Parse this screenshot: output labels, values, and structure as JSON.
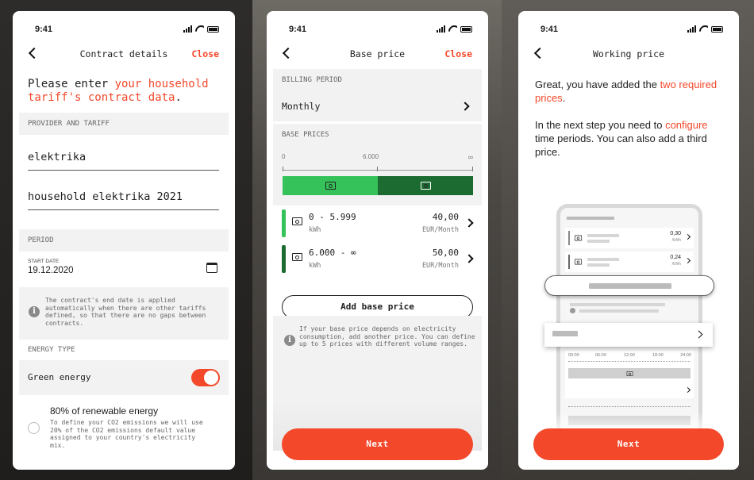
{
  "status": {
    "time": "9:41"
  },
  "screen1": {
    "nav_title": "Contract details",
    "close_label": "Close",
    "intro_prefix": "Please enter ",
    "intro_highlight": "your household tariff's contract data",
    "intro_suffix": ".",
    "provider_section": "PROVIDER AND TARIFF",
    "provider_value": "elektrika",
    "tariff_value": "household elektrika 2021",
    "period_section": "PERIOD",
    "start_date_label": "START DATE",
    "start_date_value": "19.12.2020",
    "period_info": "The contract's end date is applied automatically when there are other tariffs defined, so that there are no gaps between contracts.",
    "energy_section": "ENERGY TYPE",
    "green_energy_label": "Green energy",
    "green_energy_on": true,
    "renewable_title": "80% of renewable energy",
    "renewable_desc": "To define your CO2 emissions we will use 20% of the CO2 emissions default value assigned to your country's electricity mix."
  },
  "screen2": {
    "nav_title": "Base price",
    "close_label": "Close",
    "billing_section": "BILLING PERIOD",
    "billing_value": "Monthly",
    "prices_section": "BASE PRICES",
    "scale_labels": [
      "0",
      "6.000",
      "∞"
    ],
    "prices": [
      {
        "range": "0 - 5.999",
        "unit": "kWh",
        "amount": "40,00",
        "currency": "EUR/Month",
        "color": "#35c25a"
      },
      {
        "range": "6.000 - ∞",
        "unit": "kWh",
        "amount": "50,00",
        "currency": "EUR/Month",
        "color": "#1c6b31"
      }
    ],
    "add_label": "Add base price",
    "info_text": "If your base price depends on electricity consumption, add another price. You can define up to 5 prices with different volume ranges.",
    "next_label": "Next"
  },
  "screen3": {
    "nav_title": "Working price",
    "p1_prefix": "Great, you have added the ",
    "p1_highlight": "two required prices",
    "p1_suffix": ".",
    "p2_prefix": "In the next step you need to ",
    "p2_highlight": "configure",
    "p2_suffix": " time periods. You can also add a third price.",
    "illus_values": [
      "0,30",
      "0,24"
    ],
    "illus_unit": "/kWh",
    "illus_times": [
      "00:00",
      "06:00",
      "12:00",
      "18:00",
      "24:00"
    ],
    "next_label": "Next"
  },
  "colors": {
    "accent": "#f3482a",
    "green_light": "#35c25a",
    "green_dark": "#1c6b31"
  }
}
